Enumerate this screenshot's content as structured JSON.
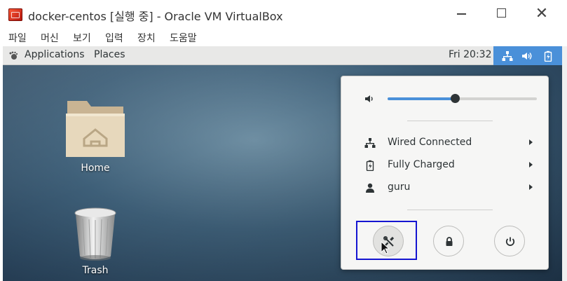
{
  "window": {
    "title": "docker-centos [실행 중] - Oracle VM VirtualBox",
    "app_icon": "virtualbox-icon",
    "controls": [
      "minimize-icon",
      "maximize-icon",
      "close-icon"
    ]
  },
  "vbox_menu": {
    "items": [
      {
        "label": "파일"
      },
      {
        "label": "머신"
      },
      {
        "label": "보기"
      },
      {
        "label": "입력"
      },
      {
        "label": "장치"
      },
      {
        "label": "도움말"
      }
    ]
  },
  "topbar": {
    "applications": "Applications",
    "places": "Places",
    "clock": "Fri 20:32",
    "status_icons": [
      "network-wired-icon",
      "volume-icon",
      "battery-icon"
    ],
    "accent": "#4a90d9"
  },
  "desktop": {
    "icons": [
      {
        "label": "Home",
        "icon": "home-folder-icon"
      },
      {
        "label": "Trash",
        "icon": "trash-icon"
      }
    ]
  },
  "system_menu": {
    "volume": {
      "icon": "volume-icon",
      "level": 0.45
    },
    "rows": [
      {
        "icon": "network-wired-icon",
        "label": "Wired Connected"
      },
      {
        "icon": "battery-full-icon",
        "label": "Fully Charged"
      },
      {
        "icon": "user-icon",
        "label": "guru"
      }
    ],
    "buttons": [
      {
        "icon": "settings-icon",
        "highlighted": true
      },
      {
        "icon": "lock-icon"
      },
      {
        "icon": "power-icon"
      }
    ]
  }
}
